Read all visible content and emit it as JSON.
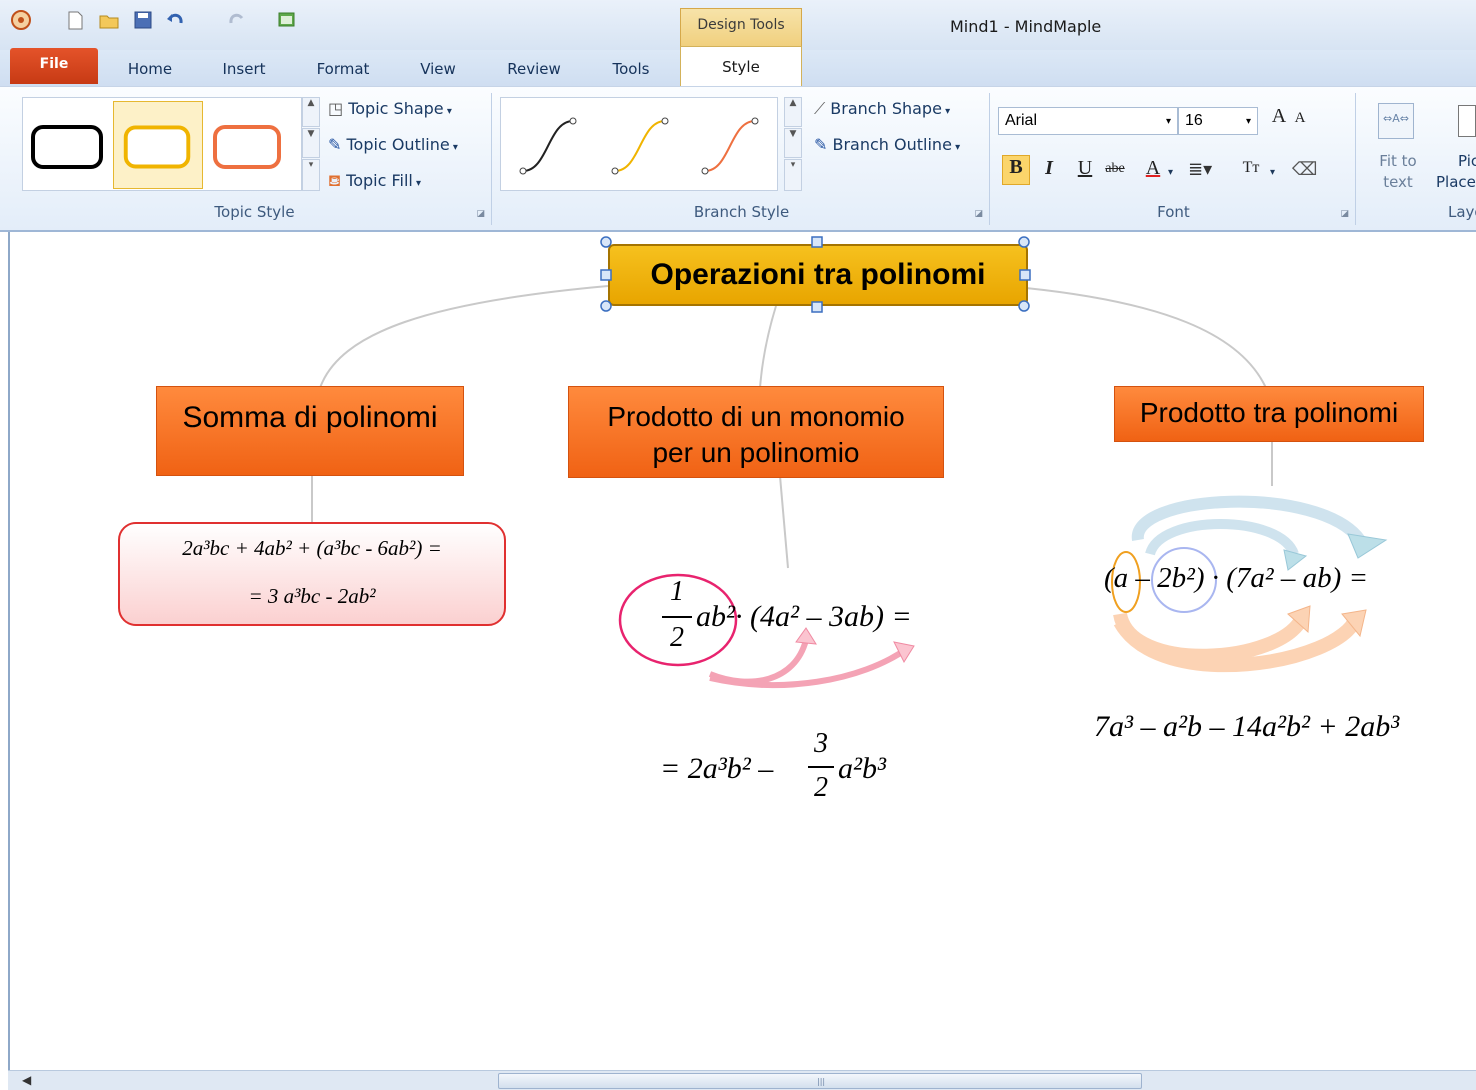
{
  "window": {
    "title": "Mind1 - MindMaple",
    "context_tab": "Design Tools"
  },
  "tabs": [
    {
      "label": "File"
    },
    {
      "label": "Home"
    },
    {
      "label": "Insert"
    },
    {
      "label": "Format"
    },
    {
      "label": "View"
    },
    {
      "label": "Review"
    },
    {
      "label": "Tools"
    },
    {
      "label": "Style"
    }
  ],
  "ribbon": {
    "topic_style": {
      "label": "Topic Style",
      "shape": "Topic Shape",
      "outline": "Topic Outline",
      "fill": "Topic Fill"
    },
    "branch_style": {
      "label": "Branch Style",
      "shape": "Branch Shape",
      "outline": "Branch Outline"
    },
    "font": {
      "label": "Font",
      "family": "Arial",
      "size": "16",
      "bold": "B",
      "italic": "I",
      "underline": "U",
      "strike": "abe",
      "color": "A",
      "grow": "A",
      "shrink": "A",
      "case": "Tт"
    },
    "layout": {
      "fit_line1": "Fit to",
      "fit_line2": "text",
      "pic_line1": "Pic",
      "pic_line2": "Place",
      "label": "Layo"
    }
  },
  "mindmap": {
    "central": "Operazioni tra polinomi",
    "topics": [
      {
        "label": "Somma di polinomi",
        "formula_line1": "2a³bc + 4ab² + (a³bc - 6ab²) =",
        "formula_line2": "= 3 a³bc - 2ab²"
      },
      {
        "label_line1": "Prodotto di un monomio",
        "label_line2": "per un polinomio",
        "frac_num": "1",
        "frac_den": "2",
        "expr": "ab²· (4a² – 3ab) =",
        "result_a": "= 2a³b² –",
        "result_num": "3",
        "result_den": "2",
        "result_b": "a²b³"
      },
      {
        "label": "Prodotto tra polinomi",
        "expr": "(a – 2b²) · (7a² – ab) =",
        "result": "7a³ – a²b – 14a²b² + 2ab³"
      }
    ]
  },
  "colors": {
    "central_fill": "#f2b705",
    "topic_fill": "#f36b1c",
    "file_tab": "#d94a1f",
    "formula_box_border": "#e03030"
  }
}
